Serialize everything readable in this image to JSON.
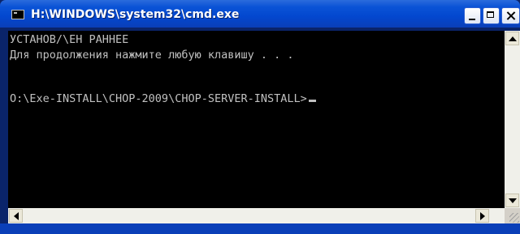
{
  "window": {
    "title": "H:\\WINDOWS\\system32\\cmd.exe",
    "icons": {
      "app": "cmd-icon",
      "minimize": "minimize-icon",
      "maximize": "maximize-icon",
      "close": "close-icon"
    }
  },
  "console": {
    "lines": [
      "УСТАНОВ/\\ЕН РАННЕЕ",
      "Для продолжения нажмите любую клавишу . . .",
      "O:\\Exe-INSTALL\\CHOP-2009\\CHOP-SERVER-INSTALL>"
    ]
  },
  "scrollbars": {
    "vertical_icons": [
      "arrow-up-icon",
      "arrow-down-icon"
    ],
    "horizontal_icons": [
      "arrow-left-icon",
      "arrow-right-icon"
    ]
  },
  "colors": {
    "titlebar": "#0347cf",
    "console_bg": "#000000",
    "console_text": "#c0c0c0"
  }
}
